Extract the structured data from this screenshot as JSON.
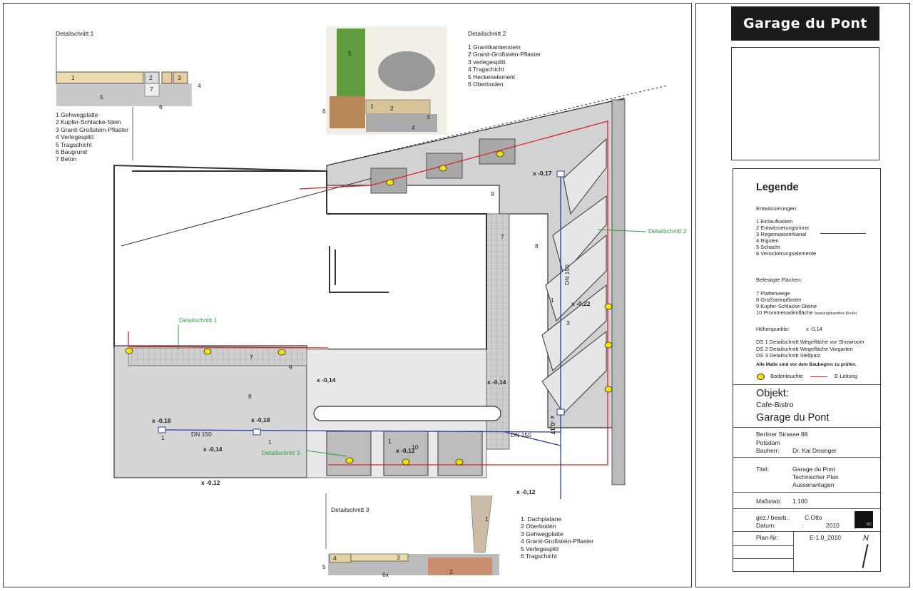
{
  "detail1": {
    "title": "Detailschnitt 1",
    "items": [
      "1  Gehwegplatte",
      "2 Kupfer-Schlacke-Stein",
      "3 Granit-Großstein-Pflaster",
      "4 Verlegesplitt",
      "5 Tragschicht",
      "6 Baugrund",
      "7 Beton"
    ],
    "nums": [
      "1",
      "2",
      "3",
      "4",
      "5",
      "6",
      "7"
    ]
  },
  "detail2": {
    "title": "Detailschnitt 2",
    "items": [
      "1 Granitkantenstein",
      "2 Granit-Großstein-Pflaster",
      "3 verlegesplitt",
      "4 Tragschicht",
      "5 Heckenelement",
      "6 Oberboden"
    ],
    "nums": [
      "1",
      "2",
      "3",
      "4",
      "5",
      "6"
    ]
  },
  "detail3": {
    "title": "Detailschnitt 3",
    "items": [
      "1. Dachplatane",
      "2 Oberboden",
      "3 Gehwegplatte",
      "4 Granit-Großstein-Pflaster",
      "5 Verlegesplitt",
      "6 Tragschicht"
    ],
    "nums": [
      "1",
      "2",
      "3",
      "4",
      "5",
      "6x"
    ]
  },
  "plan": {
    "section_labels": [
      "Detailschnitt 2",
      "Detailschnitt 1",
      "Detailschnitt 3"
    ],
    "heights": [
      "x -0,17",
      "x -0,22",
      "x -0,14",
      "x -0,14",
      "x -0,18",
      "x -0,18",
      "x -0,14",
      "x -0,12",
      "x -0,12",
      "x -0,12",
      "x -0,17"
    ],
    "pipe_labels": [
      "DN 150",
      "DN 150",
      "DN 150"
    ],
    "area_nums": [
      "9",
      "7",
      "8",
      "7",
      "9",
      "8",
      "1",
      "1",
      "1",
      "3",
      "1",
      "10"
    ],
    "colors": {
      "red_line": "#d9232d",
      "blue_line": "#2b3f9e",
      "green_text": "#2a9d3a",
      "lamp": "#f5e300"
    }
  },
  "brand": {
    "name": "Garage du Pont"
  },
  "photo": {
    "icon": "sketch-image-icon"
  },
  "legend": {
    "title": "Legende",
    "drainage_header": "Entwässerungen:",
    "drainage": [
      "1  Einlaufkasten",
      "2  Entwässerungsrinne",
      "3  Regenwasserkanal",
      "4  Rigolen",
      "5  Schacht",
      "6  Versickerungselemente"
    ],
    "surfaces_header": "Befestigte Flächen:",
    "surfaces": [
      "7  Plattenwege",
      "8  Großsteinpflaster",
      "9  Kupfer-Schlacke-Steine"
    ],
    "surface10": "10 Prommenadenfläche",
    "surface10_note": "(wassergebundene Decke)",
    "heights_label": "Höhenpunkte:",
    "heights_example": "x -0,14",
    "ds": [
      "DS 1   Detailschnitt Wegefläche vor Showroom",
      "DS 2   Detailschnitt Wegefläche Vorgarten",
      "DS 3   Detailschnitt Stellpatz"
    ],
    "note": "Alle Maße sind vor dem Baubeginn zu prüfen.",
    "lamp_label": "Bodenleuchte",
    "eline_label": "E-Leitung"
  },
  "project": {
    "objekt_label": "Objekt:",
    "objekt_sub": "Cafe-Bistro",
    "objekt_name": "Garage du Pont",
    "address1": "Berliner Strasse 88",
    "address2": "Potsdam",
    "bauherr_label": "Bauherr:",
    "bauherr": "Dr. Kai Desinger",
    "titel_label": "Titel:",
    "titel": [
      "Garage du Pont",
      "Technischer Plan",
      "Aussenanlagen"
    ],
    "massstab_label": "Maßstab:",
    "massstab": "1:100",
    "gez_label": "gez./ bearb.:",
    "gez": "C.Otto",
    "datum_label": "Datum:",
    "datum_colon": ":",
    "datum": "2010",
    "plannr_label": "Plan-Nr.",
    "plannr": "E-1.0_2010",
    "logo_text": "DC",
    "north": "N"
  }
}
